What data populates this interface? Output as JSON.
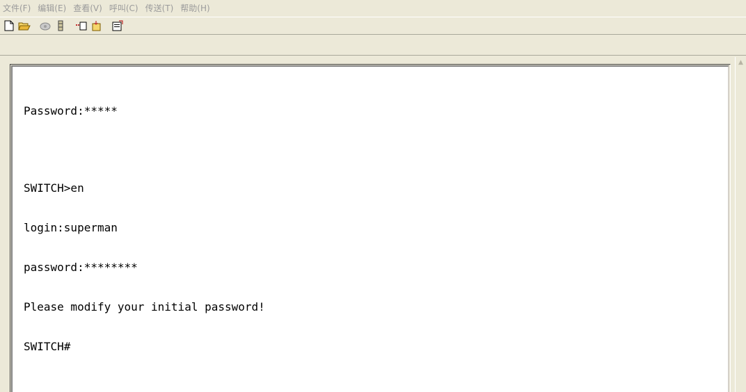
{
  "menu": {
    "items": [
      "文件(F)",
      "编辑(E)",
      "查看(V)",
      "呼叫(C)",
      "传送(T)",
      "帮助(H)"
    ]
  },
  "toolbar": {
    "buttons": [
      "new-file-icon",
      "open-folder-icon",
      "call-phone-icon",
      "disconnect-icon",
      "send-icon",
      "receive-icon",
      "properties-icon"
    ]
  },
  "terminal": {
    "lines": [
      "Password:*****",
      "",
      "SWITCH>en",
      "login:superman",
      "password:********",
      "Please modify your initial password!",
      "SWITCH#"
    ]
  },
  "colors": {
    "chrome": "#ECE9D8",
    "terminal_bg": "#FFFFFF",
    "terminal_text": "#000000",
    "menu_text_disabled": "#9B9B9B"
  }
}
